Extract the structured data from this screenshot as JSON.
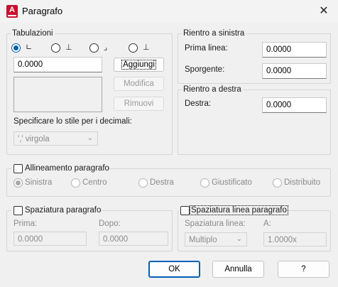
{
  "window": {
    "title": "Paragrafo",
    "icon_letter": "A",
    "close_glyph": "✕"
  },
  "tabs_group": {
    "title": "Tabulazioni",
    "tab_types": [
      {
        "glyph": "∟",
        "selected": true
      },
      {
        "glyph": "⊥",
        "selected": false
      },
      {
        "glyph": "⌟",
        "selected": false
      },
      {
        "glyph": "⊥",
        "selected": false
      }
    ],
    "position_value": "0.0000",
    "add_label": "Aggiungi",
    "modify_label": "Modifica",
    "remove_label": "Rimuovi",
    "decimal_label": "Specificare lo stile per i decimali:",
    "decimal_value": "',' virgola"
  },
  "left_indent": {
    "title": "Rientro a sinistra",
    "first_line_label": "Prima linea:",
    "first_line_value": "0.0000",
    "hanging_label": "Sporgente:",
    "hanging_value": "0.0000"
  },
  "right_indent": {
    "title": "Rientro a destra",
    "right_label": "Destra:",
    "right_value": "0.0000"
  },
  "alignment": {
    "checkbox_label": "Allineamento paragrafo",
    "checked": false,
    "options": [
      {
        "label": "Sinistra",
        "selected": true
      },
      {
        "label": "Centro",
        "selected": false
      },
      {
        "label": "Destra",
        "selected": false
      },
      {
        "label": "Giustificato",
        "selected": false
      },
      {
        "label": "Distribuito",
        "selected": false
      }
    ]
  },
  "para_spacing": {
    "checkbox_label": "Spaziatura paragrafo",
    "checked": false,
    "before_label": "Prima:",
    "before_value": "0.0000",
    "after_label": "Dopo:",
    "after_value": "0.0000"
  },
  "line_spacing": {
    "checkbox_label": "Spaziatura linea paragrafo",
    "checked": false,
    "type_label": "Spaziatura linea:",
    "type_value": "Multiplo",
    "at_label": "A:",
    "at_value": "1.0000x"
  },
  "footer": {
    "ok_label": "OK",
    "cancel_label": "Annulla",
    "help_label": "?"
  },
  "colors": {
    "accent": "#005fb8",
    "app_icon": "#c8102e",
    "background": "#f0f0f0"
  }
}
